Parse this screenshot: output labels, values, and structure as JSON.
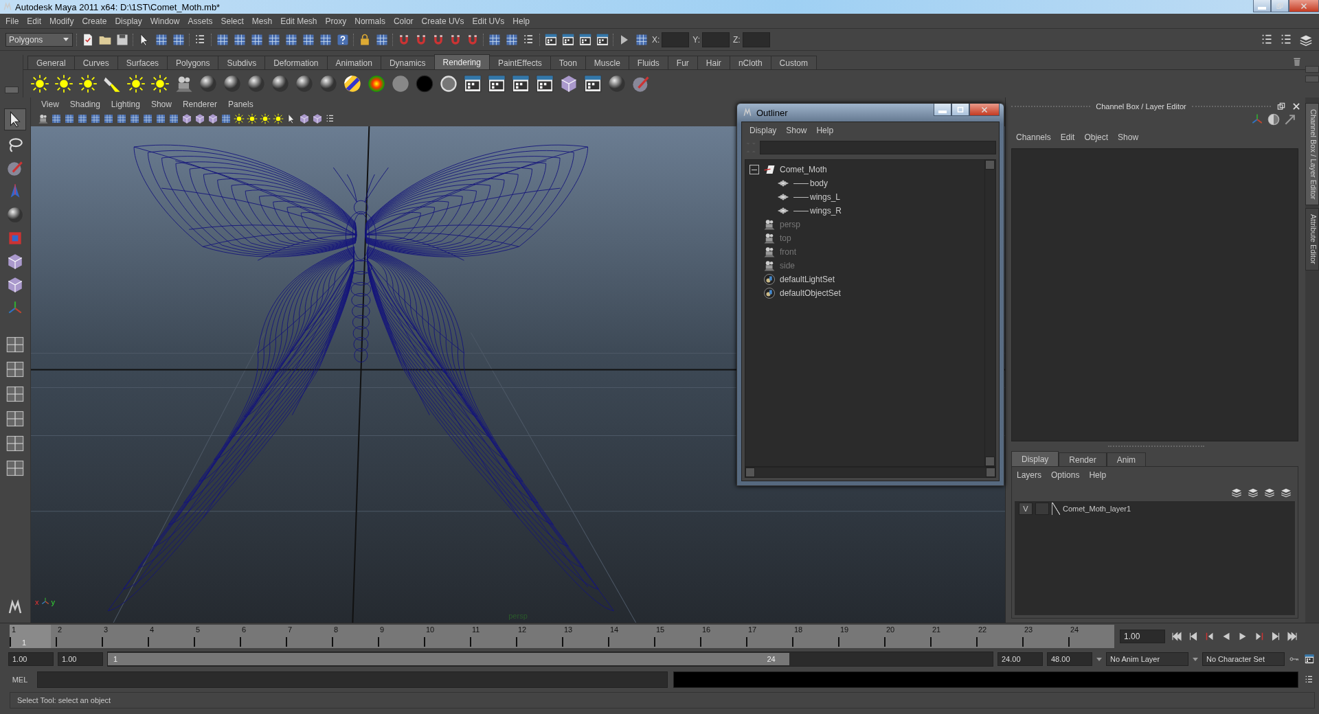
{
  "window": {
    "title": "Autodesk Maya 2011 x64: D:\\1ST\\Comet_Moth.mb*"
  },
  "menu_bar": [
    "File",
    "Edit",
    "Modify",
    "Create",
    "Display",
    "Window",
    "Assets",
    "Select",
    "Mesh",
    "Edit Mesh",
    "Proxy",
    "Normals",
    "Color",
    "Create UVs",
    "Edit UVs",
    "Help"
  ],
  "status_line": {
    "mode": "Polygons",
    "coords": [
      {
        "label": "X:"
      },
      {
        "label": "Y:"
      },
      {
        "label": "Z:"
      }
    ]
  },
  "shelf_tabs": [
    {
      "label": "General",
      "selected": false
    },
    {
      "label": "Curves",
      "selected": false
    },
    {
      "label": "Surfaces",
      "selected": false
    },
    {
      "label": "Polygons",
      "selected": false
    },
    {
      "label": "Subdivs",
      "selected": false
    },
    {
      "label": "Deformation",
      "selected": false
    },
    {
      "label": "Animation",
      "selected": false
    },
    {
      "label": "Dynamics",
      "selected": false
    },
    {
      "label": "Rendering",
      "selected": true
    },
    {
      "label": "PaintEffects",
      "selected": false
    },
    {
      "label": "Toon",
      "selected": false
    },
    {
      "label": "Muscle",
      "selected": false
    },
    {
      "label": "Fluids",
      "selected": false
    },
    {
      "label": "Fur",
      "selected": false
    },
    {
      "label": "Hair",
      "selected": false
    },
    {
      "label": "nCloth",
      "selected": false
    },
    {
      "label": "Custom",
      "selected": false
    }
  ],
  "viewport": {
    "menu": [
      "View",
      "Shading",
      "Lighting",
      "Show",
      "Renderer",
      "Panels"
    ],
    "camera_label": "persp",
    "axis_labels": [
      "x",
      "y"
    ]
  },
  "outliner": {
    "title": "Outliner",
    "menu": [
      "Display",
      "Show",
      "Help"
    ],
    "items": [
      {
        "name": "Comet_Moth",
        "kind": "transform",
        "dimmed": false,
        "expanded": true,
        "children": [
          {
            "name": "body",
            "kind": "mesh",
            "dimmed": false
          },
          {
            "name": "wings_L",
            "kind": "mesh",
            "dimmed": false
          },
          {
            "name": "wings_R",
            "kind": "mesh",
            "dimmed": false
          }
        ]
      },
      {
        "name": "persp",
        "kind": "camera",
        "dimmed": true
      },
      {
        "name": "top",
        "kind": "camera",
        "dimmed": true
      },
      {
        "name": "front",
        "kind": "camera",
        "dimmed": true
      },
      {
        "name": "side",
        "kind": "camera",
        "dimmed": true
      },
      {
        "name": "defaultLightSet",
        "kind": "set",
        "dimmed": false
      },
      {
        "name": "defaultObjectSet",
        "kind": "set",
        "dimmed": false
      }
    ]
  },
  "channel_box": {
    "title": "Channel Box / Layer Editor",
    "menu": [
      "Channels",
      "Edit",
      "Object",
      "Show"
    ]
  },
  "layer_editor": {
    "tabs": [
      {
        "label": "Display",
        "selected": true
      },
      {
        "label": "Render",
        "selected": false
      },
      {
        "label": "Anim",
        "selected": false
      }
    ],
    "menu": [
      "Layers",
      "Options",
      "Help"
    ],
    "layers": [
      {
        "visibility": "V",
        "name": "Comet_Moth_layer1"
      }
    ]
  },
  "side_tabs": [
    {
      "label": "Channel Box / Layer Editor",
      "selected": true
    },
    {
      "label": "Attribute Editor",
      "selected": false
    }
  ],
  "timeline": {
    "ticks": [
      "1",
      "2",
      "3",
      "4",
      "5",
      "6",
      "7",
      "8",
      "9",
      "10",
      "11",
      "12",
      "13",
      "14",
      "15",
      "16",
      "17",
      "18",
      "19",
      "20",
      "21",
      "22",
      "23",
      "24"
    ],
    "current_frame": "1",
    "current_time": "1.00",
    "level": 0
  },
  "range": {
    "start": "1.00",
    "playback_start": "1.00",
    "slider_start": "1",
    "slider_end": "24",
    "level": 0.77,
    "playback_end": "24.00",
    "end": "48.00",
    "anim_layer": "No Anim Layer",
    "character_set": "No Character Set"
  },
  "command_line": {
    "label": "MEL"
  },
  "help_line": "Select Tool: select an object"
}
